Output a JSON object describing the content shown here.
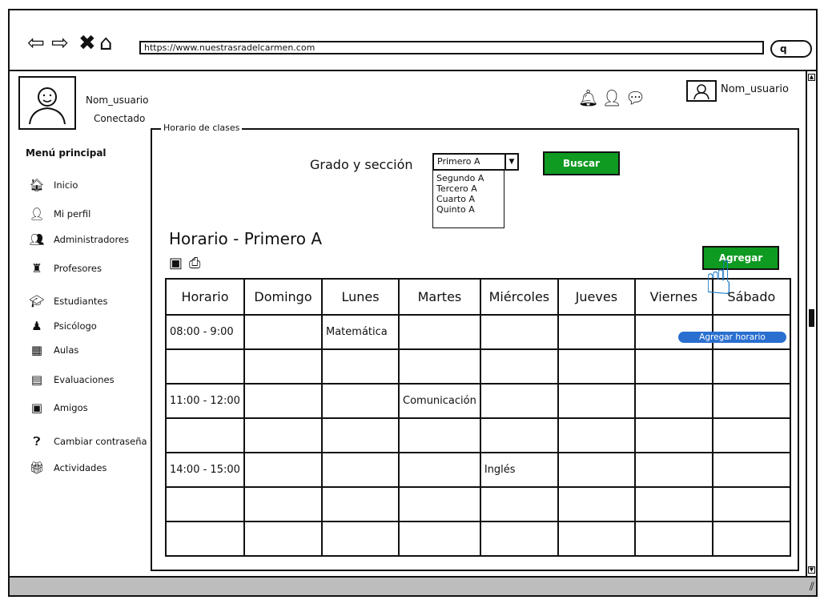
{
  "browser": {
    "url": "https://www.nuestrasradelcarmen.com",
    "nav_icons": [
      "back-arrow-icon",
      "forward-arrow-icon",
      "close-icon",
      "home-icon"
    ]
  },
  "user": {
    "name": "Nom_usuario",
    "status": "Conectado"
  },
  "header": {
    "icons": [
      "bell-icon",
      "add-user-icon",
      "chat-icon"
    ],
    "user_name": "Nom_usuario"
  },
  "sidebar": {
    "title": "Menú principal",
    "items": [
      {
        "label": "Inicio",
        "icon": "home-icon"
      },
      {
        "label": "Mi perfil",
        "icon": "user-icon"
      },
      {
        "label": "Administradores",
        "icon": "users-icon"
      },
      {
        "label": "Profesores",
        "icon": "teacher-icon"
      },
      {
        "label": "Estudiantes",
        "icon": "graduation-cap-icon"
      },
      {
        "label": "Psicólogo",
        "icon": "psychologist-icon"
      },
      {
        "label": "Aulas",
        "icon": "classroom-icon"
      },
      {
        "label": "Evaluaciones",
        "icon": "document-icon"
      },
      {
        "label": "Amigos",
        "icon": "address-book-icon"
      },
      {
        "label": "Cambiar contraseña",
        "icon": "question-icon"
      },
      {
        "label": "Actividades",
        "icon": "gift-icon"
      }
    ]
  },
  "main": {
    "legend": "Horario de clases",
    "grado_label": "Grado y sección",
    "select_value": "Primero A",
    "options": [
      "Segundo A",
      "Tercero A",
      "Cuarto A",
      "Quinto A"
    ],
    "buscar": "Buscar",
    "schedule_title": "Horario - Primero A",
    "agregar": "Agregar",
    "tooltip": "Agregar horario",
    "columns": [
      "Horario",
      "Domingo",
      "Lunes",
      "Martes",
      "Miércoles",
      "Jueves",
      "Viernes",
      "Sábado"
    ],
    "rows": [
      [
        "08:00 - 9:00",
        "",
        "Matemática",
        "",
        "",
        "",
        "",
        ""
      ],
      [
        "",
        "",
        "",
        "",
        "",
        "",
        "",
        ""
      ],
      [
        "11:00 - 12:00",
        "",
        "",
        "Comunicación",
        "",
        "",
        "",
        ""
      ],
      [
        "",
        "",
        "",
        "",
        "",
        "",
        "",
        ""
      ],
      [
        "14:00 - 15:00",
        "",
        "",
        "",
        "Inglés",
        "",
        "",
        ""
      ],
      [
        "",
        "",
        "",
        "",
        "",
        "",
        "",
        ""
      ],
      [
        "",
        "",
        "",
        "",
        "",
        "",
        "",
        ""
      ]
    ]
  },
  "colors": {
    "button_green": "#0f9a21",
    "cursor_blue": "#1a79c9",
    "tooltip_blue": "#2a6fd0"
  }
}
